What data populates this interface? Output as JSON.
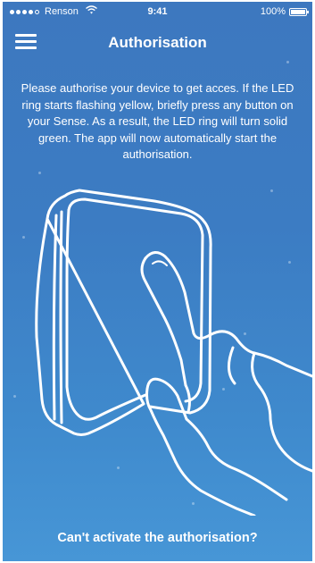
{
  "status_bar": {
    "carrier": "Renson",
    "time": "9:41",
    "battery_percent_label": "100%",
    "battery_level": 1.0,
    "wifi_icon": "wifi-icon",
    "signal_bars_filled": 4,
    "signal_bars_total": 5
  },
  "nav": {
    "menu_icon": "hamburger-menu-icon",
    "title": "Authorisation"
  },
  "instructions": "Please authorise your device to get acces. If the LED ring starts flashing yellow, briefly press any button on your Sense. As a result, the LED ring will turn solid green. The app will now automatically start the authorisation.",
  "illustration": "hand-pressing-device-illustration",
  "footer": {
    "help_link": "Can't activate the authorisation?"
  },
  "colors": {
    "background_top": "#3d78bf",
    "background_bottom": "#4796d6",
    "foreground": "#ffffff"
  }
}
